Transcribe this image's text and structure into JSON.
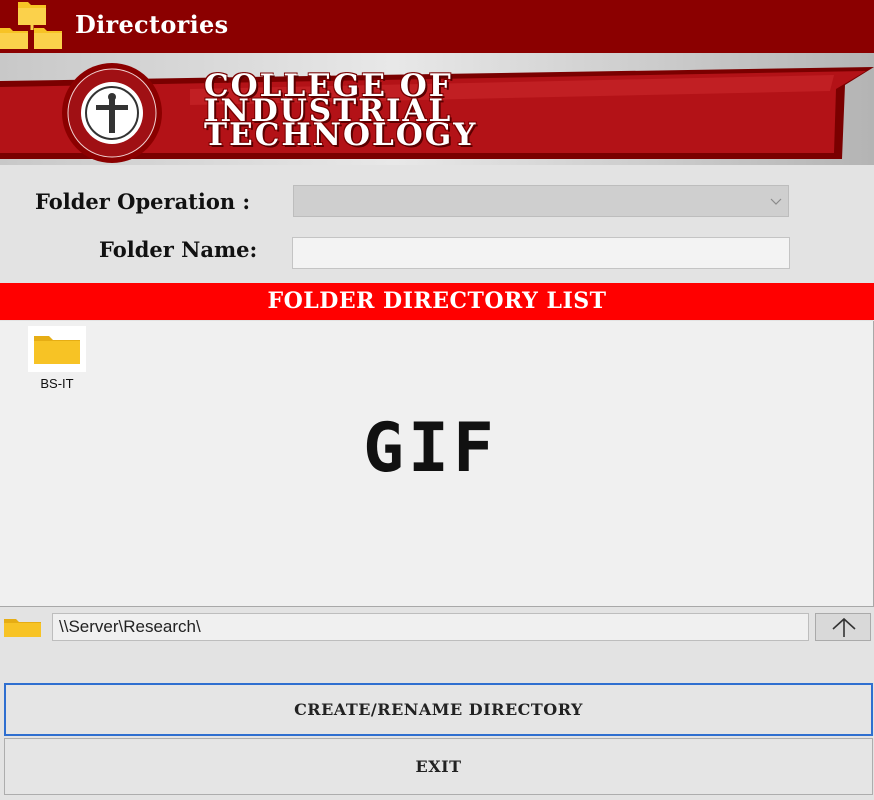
{
  "window": {
    "title": "Directories",
    "app_icon": "folder-tree-icon"
  },
  "banner": {
    "line1": "COLLEGE OF",
    "line2": "INDUSTRIAL",
    "line3": "TECHNOLOGY",
    "logo": "college-seal-icon",
    "colors": {
      "red": "#b31217",
      "dark_red": "#7a0000"
    }
  },
  "form": {
    "operation_label": "Folder Operation :",
    "operation_value": "",
    "name_label": "Folder Name:",
    "name_value": ""
  },
  "list": {
    "header": "FOLDER DIRECTORY LIST",
    "items": [
      {
        "label": "BS-IT",
        "icon": "folder-icon"
      }
    ],
    "overlay_text": "GIF"
  },
  "path": {
    "value": "\\\\Server\\Research\\",
    "up_icon": "arrow-up-icon"
  },
  "buttons": {
    "create": "CREATE/RENAME DIRECTORY",
    "exit": "EXIT"
  },
  "colors": {
    "titlebar": "#8b0000",
    "list_header": "#ff0000",
    "folder_yellow": "#f7c325",
    "button_focus": "#2f6fd0"
  }
}
